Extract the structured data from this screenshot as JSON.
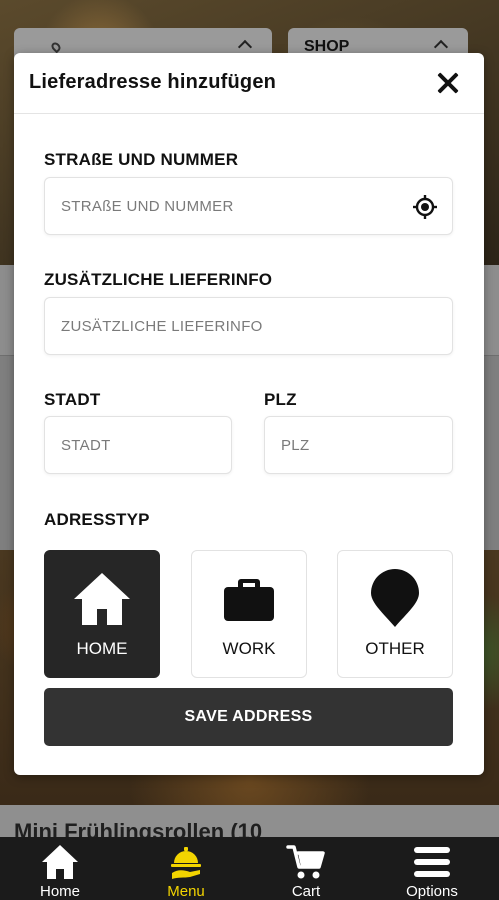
{
  "background": {
    "location_select_label": "",
    "shop_select_label": "SHOP",
    "partial_menu_text": "Mini Frühlingsrollen (10"
  },
  "modal": {
    "title": "Lieferadresse hinzufügen",
    "street": {
      "label": "STRAßE UND NUMMER",
      "placeholder": "STRAßE UND NUMMER",
      "value": ""
    },
    "extra_info": {
      "label": "ZUSÄTZLICHE LIEFERINFO",
      "placeholder": "ZUSÄTZLICHE LIEFERINFO",
      "value": ""
    },
    "city": {
      "label": "STADT",
      "placeholder": "STADT",
      "value": ""
    },
    "zip": {
      "label": "PLZ",
      "placeholder": "PLZ",
      "value": ""
    },
    "address_type": {
      "label": "ADRESSTYP",
      "selected": "HOME",
      "options": [
        {
          "label": "HOME",
          "icon": "home-icon"
        },
        {
          "label": "WORK",
          "icon": "briefcase-icon"
        },
        {
          "label": "OTHER",
          "icon": "map-pin-icon"
        }
      ]
    },
    "save_label": "SAVE ADDRESS"
  },
  "bottom_nav": {
    "active": "Menu",
    "items": [
      {
        "label": "Home",
        "icon": "home-icon"
      },
      {
        "label": "Menu",
        "icon": "food-delivery-icon"
      },
      {
        "label": "Cart",
        "icon": "cart-icon"
      },
      {
        "label": "Options",
        "icon": "menu-bars-icon"
      }
    ]
  },
  "colors": {
    "accent": "#f3d400",
    "selected_tile": "#262626",
    "save_button": "#333333",
    "nav_background": "#1b1b1b"
  }
}
